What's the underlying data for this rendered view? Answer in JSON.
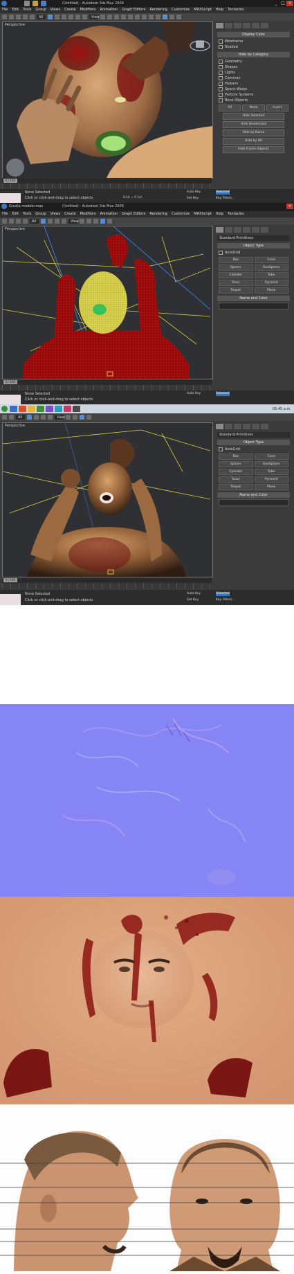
{
  "window": {
    "title": "(Untitled) - Autodesk 3ds Max 2009",
    "file_label": "Gruela modelo.max"
  },
  "menu": [
    "File",
    "Edit",
    "Tools",
    "Group",
    "Views",
    "Create",
    "Modifiers",
    "Animation",
    "Graph Editors",
    "Rendering",
    "Customize",
    "MAXScript",
    "Help",
    "Tentacles"
  ],
  "toolbar": {
    "selection_filter": "All",
    "view_dropdown": "View"
  },
  "command_panel": {
    "category_dropdown": "Standard Primitives",
    "rollouts": {
      "object_type": "Object Type",
      "name_and_color": "Name and Color"
    },
    "autogrid": "AutoGrid",
    "object_buttons": [
      "Box",
      "Cone",
      "Sphere",
      "GeoSphere",
      "Cylinder",
      "Tube",
      "Torus",
      "Pyramid",
      "Teapot",
      "Plane"
    ],
    "display_title": "Display Color",
    "display_list": [
      "Wireframe",
      "Shaded"
    ],
    "hide_by_category": "Hide by Category",
    "hide_items": [
      "Geometry",
      "Shapes",
      "Lights",
      "Cameras",
      "Helpers",
      "Space Warps",
      "Particle Systems",
      "Bone Objects"
    ],
    "hide_buttons": [
      "Hide Selected",
      "Hide Unselected",
      "Hide by Name",
      "Hide by Hit",
      "Hide Frozen Objects"
    ],
    "all_label": "All",
    "none_label": "None",
    "invert_label": "Invert"
  },
  "viewports": [
    {
      "label": "Perspective"
    },
    {
      "label": "Perspective"
    },
    {
      "label": "Perspective"
    }
  ],
  "timeline": {
    "frame": "0 / 100"
  },
  "status": {
    "selection": "None Selected",
    "prompt": "Click or click-and-drag to select objects",
    "grid": "Grid = 0.1m",
    "autokey": "Auto Key",
    "setkey": "Set Key",
    "selected": "Selected",
    "key_filters": "Key Filters..."
  },
  "taskbar": {
    "time": "05:45 p.m."
  },
  "colors": {
    "ui_dark": "#3b3b3b",
    "viewport_bg": "#2d2f33",
    "wire_red": "#c21a1a",
    "wire_yellow": "#e6df3c",
    "normal_map": "#8080ff",
    "skin_atlas": "#d9a07a"
  }
}
